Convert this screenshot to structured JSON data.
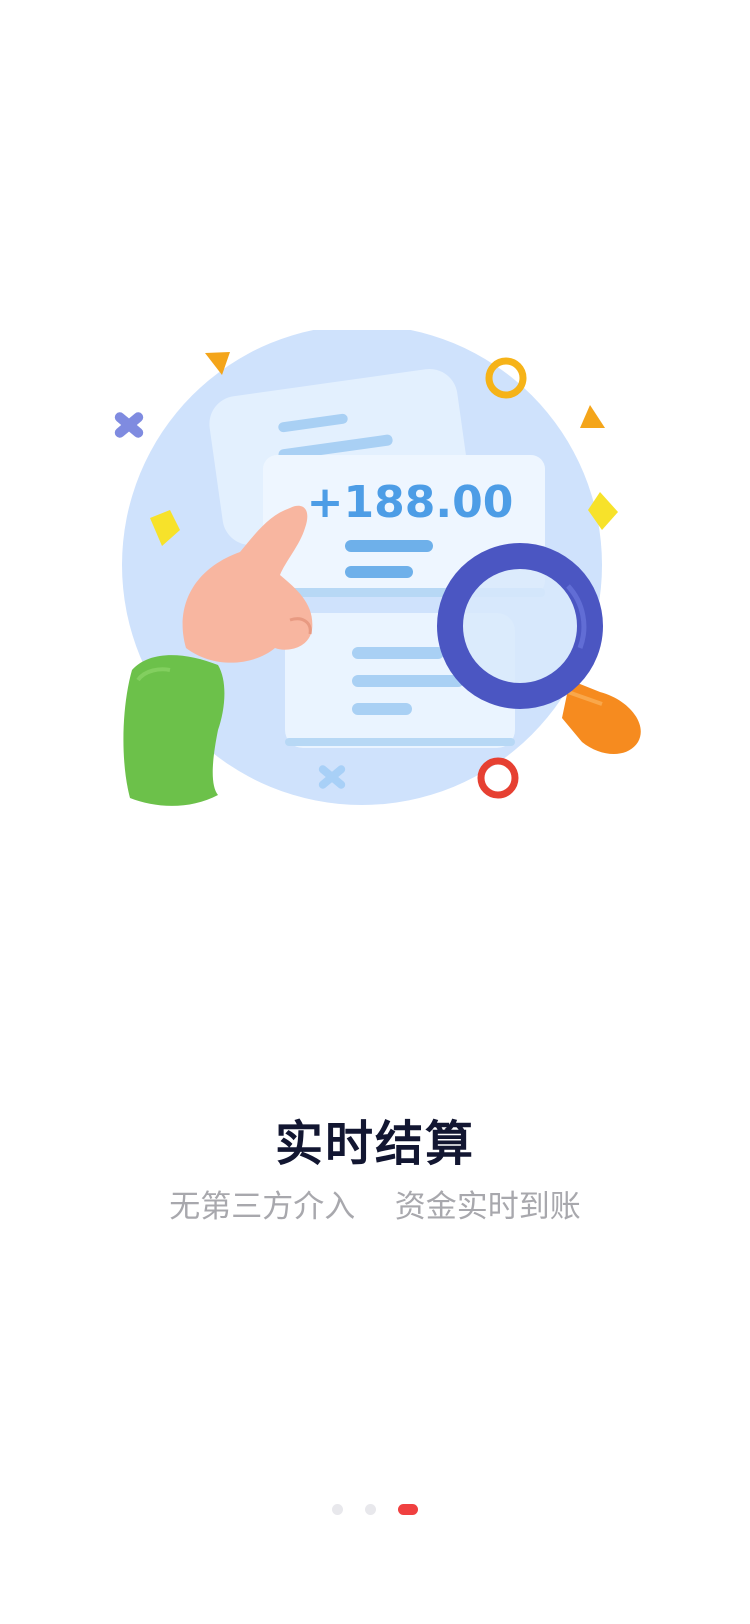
{
  "illustration": {
    "amount": "+188.00",
    "icon": "receipt-magnifier-illustration"
  },
  "onboarding": {
    "title": "实时结算",
    "subtitle": "无第三方介入    资金实时到账"
  },
  "pager": {
    "total_pages": 3,
    "active_index": 2
  },
  "colors": {
    "title": "#121631",
    "subtitle": "#a8a8ad",
    "active_dot": "#f04040",
    "inactive_dot": "#e8e8ec",
    "circle_bg": "#cfe2fc",
    "receipt": "#eaf4ff",
    "receipt_line": "#8cc1f0",
    "magnifier_ring": "#4b56c2",
    "magnifier_handle": "#f68b1f",
    "sleeve": "#6cc14a",
    "hand": "#f8b6a0"
  }
}
